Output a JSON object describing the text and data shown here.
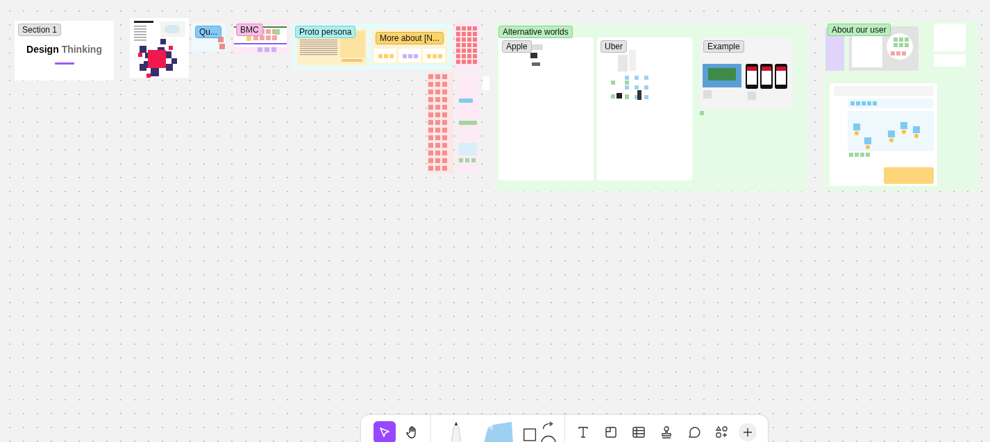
{
  "board": {
    "sections": [
      {
        "kind": "title-card",
        "label": "Section 1",
        "color": "#e3e3e3",
        "title": "Design",
        "title_accent": "Thinking"
      },
      {
        "kind": "schedule-card"
      },
      {
        "kind": "frame",
        "label": "Qu...",
        "color": "#85c9f7"
      },
      {
        "kind": "frame",
        "label": "BMC",
        "color": "#f8bce6"
      },
      {
        "kind": "frame",
        "label": "Proto persona",
        "color": "#aaf0f0",
        "children": [
          {
            "label": "More about [N...",
            "color": "#fbd36b"
          }
        ]
      },
      {
        "kind": "stickies"
      },
      {
        "kind": "frame",
        "label": "Alternative worlds",
        "color": "#b9efbe",
        "children": [
          {
            "label": "Apple",
            "color": "#e3e3e3"
          },
          {
            "label": "Uber",
            "color": "#e3e3e3"
          },
          {
            "label": "Example",
            "color": "#e3e3e3"
          }
        ]
      },
      {
        "kind": "frame",
        "label": "About our user",
        "color": "#b9efbe"
      }
    ]
  },
  "toolbar": {
    "groups": [
      {
        "tools": [
          {
            "kind": "select",
            "selected": true
          },
          {
            "kind": "hand",
            "selected": false
          }
        ]
      },
      {
        "tools": [
          {
            "kind": "pen",
            "selected": false
          },
          {
            "kind": "sticky",
            "selected": false
          },
          {
            "kind": "shapes",
            "selected": false
          }
        ]
      },
      {
        "tools": [
          {
            "kind": "text",
            "selected": false
          },
          {
            "kind": "section",
            "selected": false
          },
          {
            "kind": "table",
            "selected": false
          },
          {
            "kind": "stamp",
            "selected": false
          },
          {
            "kind": "comment",
            "selected": false
          },
          {
            "kind": "widgets",
            "selected": false
          },
          {
            "kind": "add",
            "selected": false
          }
        ]
      }
    ]
  }
}
